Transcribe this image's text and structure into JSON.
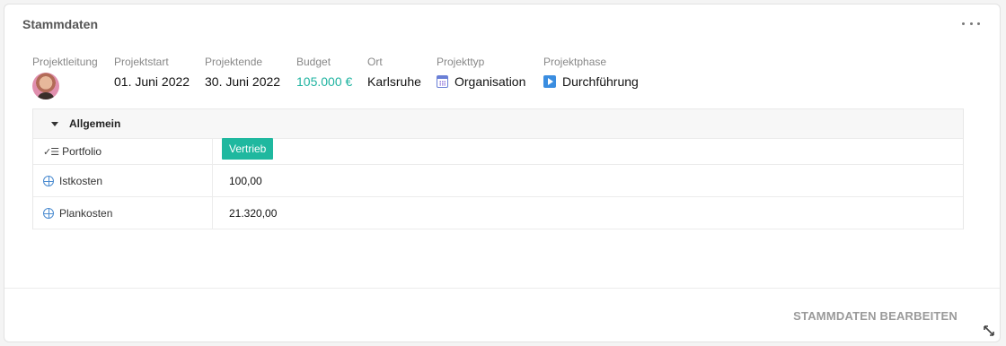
{
  "card": {
    "title": "Stammdaten"
  },
  "fields": {
    "projektleitung": {
      "label": "Projektleitung"
    },
    "projektstart": {
      "label": "Projektstart",
      "value": "01. Juni 2022"
    },
    "projektende": {
      "label": "Projektende",
      "value": "30. Juni 2022"
    },
    "budget": {
      "label": "Budget",
      "value": "105.000 €"
    },
    "ort": {
      "label": "Ort",
      "value": "Karlsruhe"
    },
    "projekttyp": {
      "label": "Projekttyp",
      "value": "Organisation",
      "icon": "calendar-icon"
    },
    "projektphase": {
      "label": "Projektphase",
      "value": "Durchführung",
      "icon": "play-icon"
    }
  },
  "section": {
    "title": "Allgemein",
    "rows": [
      {
        "label": "Portfolio",
        "icon": "checklist-icon",
        "value": "Vertrieb"
      },
      {
        "label": "Istkosten",
        "icon": "globe-icon",
        "value": "100,00"
      },
      {
        "label": "Plankosten",
        "icon": "globe-icon",
        "value": "21.320,00"
      }
    ]
  },
  "footer": {
    "edit_label": "STAMMDATEN BEARBEITEN"
  },
  "colors": {
    "accent": "#1fb3a0",
    "tag": "#1fb89f"
  }
}
